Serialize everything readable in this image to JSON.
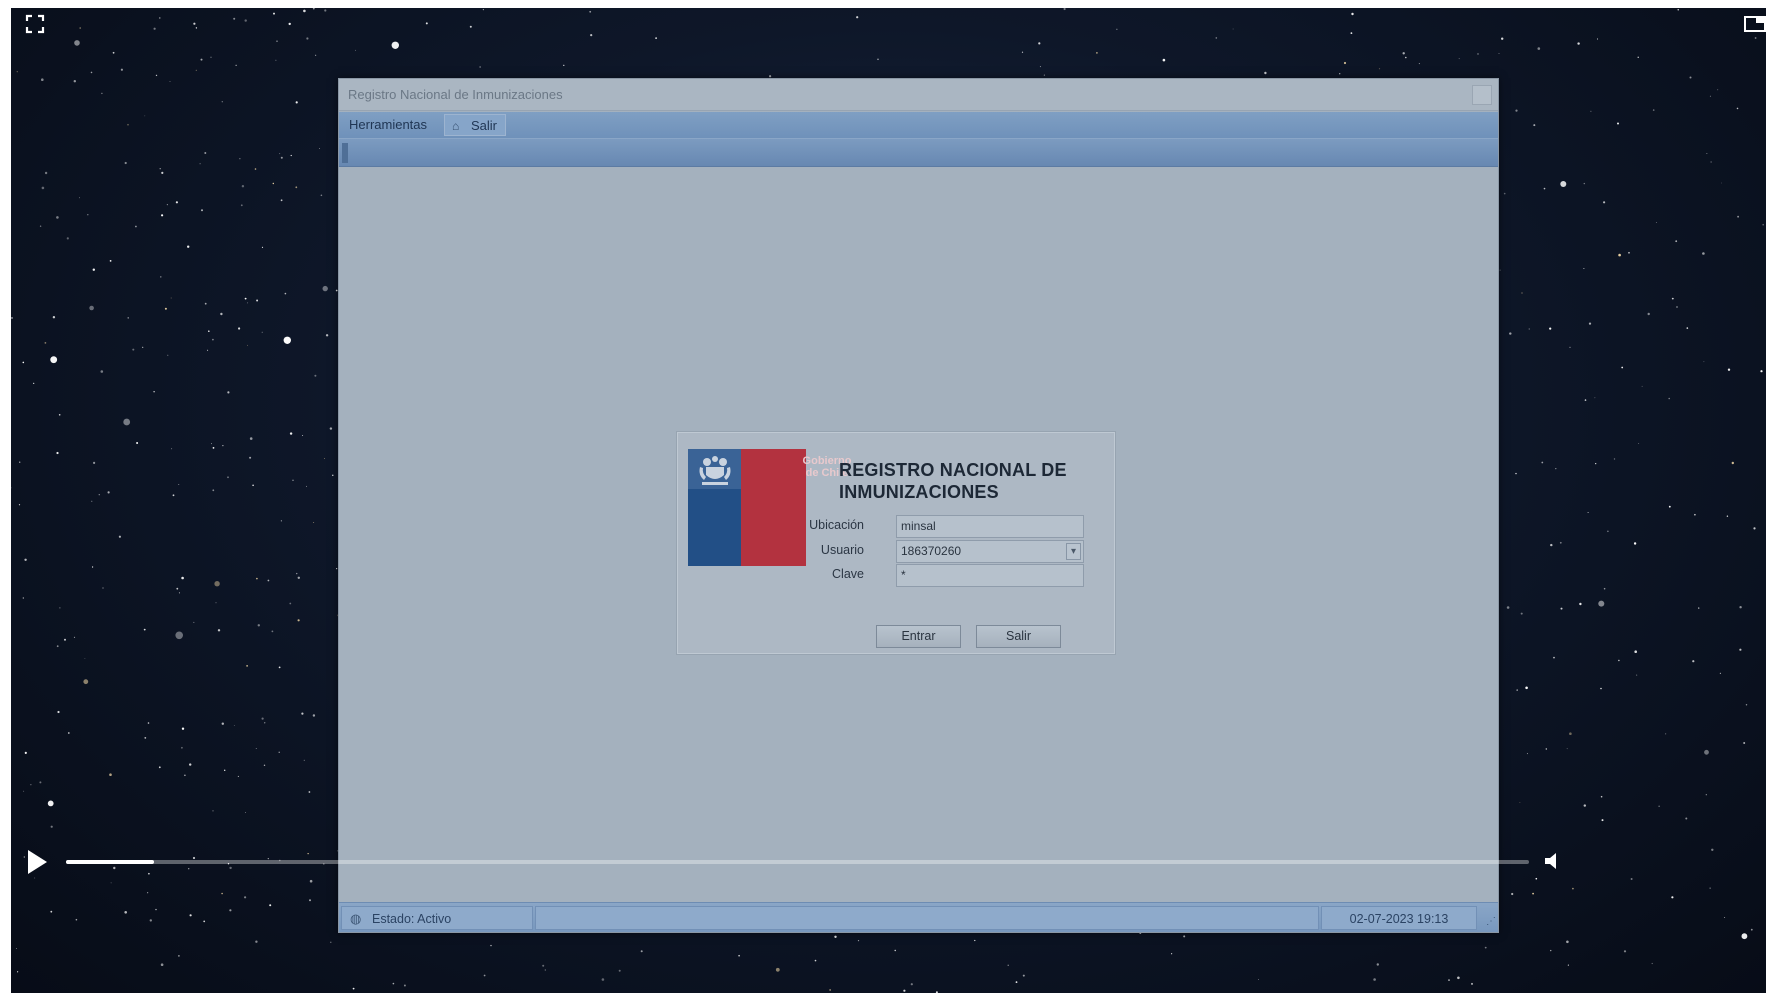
{
  "window": {
    "title": "Registro Nacional de Inmunizaciones"
  },
  "menu": {
    "tools_label": "Herramientas",
    "exit_label": "Salir",
    "exit_icon": "home-icon"
  },
  "login": {
    "logo": {
      "line1": "Gobierno",
      "line2": "de Chile",
      "blue": "#224f86",
      "red": "#b3323f"
    },
    "title_line1": "REGISTRO NACIONAL DE",
    "title_line2": "INMUNIZACIONES",
    "location_label": "Ubicación",
    "location_value": "minsal",
    "user_label": "Usuario",
    "user_value": "186370260",
    "password_label": "Clave",
    "password_value": "*",
    "enter_label": "Entrar",
    "exit_label": "Salir"
  },
  "statusbar": {
    "state_text": "Estado: Activo",
    "datetime": "02-07-2023 19:13"
  },
  "player": {
    "progress_fraction": 0.06,
    "accent": "#ffffff"
  }
}
